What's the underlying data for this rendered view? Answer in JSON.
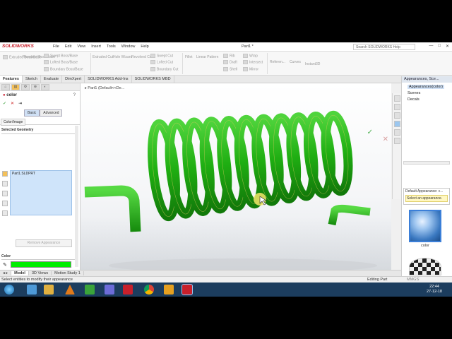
{
  "app": {
    "brand": "SOLIDWORKS",
    "menu": [
      "File",
      "Edit",
      "View",
      "Insert",
      "Tools",
      "Window",
      "Help"
    ],
    "document_title": "Part1 *",
    "search_placeholder": "Search SOLIDWORKS Help"
  },
  "commands": {
    "extruded_boss": "Extruded Boss/Base",
    "revolved_boss": "Revolved Boss/Base",
    "swept_boss": "Swept Boss/Base",
    "lofted_boss": "Lofted Boss/Base",
    "boundary_boss": "Boundary Boss/Base",
    "extruded_cut": "Extruded Cut",
    "hole_wizard": "Hole Wizard",
    "revolved_cut": "Revolved Cut",
    "swept_cut": "Swept Cut",
    "lofted_cut": "Lofted Cut",
    "boundary_cut": "Boundary Cut",
    "fillet": "Fillet",
    "linear_pattern": "Linear Pattern",
    "rib": "Rib",
    "draft": "Draft",
    "shell": "Shell",
    "wrap": "Wrap",
    "intersect": "Intersect",
    "mirror": "Mirror",
    "reference": "Referen...",
    "curves": "Curves",
    "instant3d": "Instant3D"
  },
  "tabs": [
    "Features",
    "Sketch",
    "Evaluate",
    "DimXpert",
    "SOLIDWORKS Add-Ins",
    "SOLIDWORKS MBD"
  ],
  "property_manager": {
    "title": "color",
    "help": "?",
    "ok": "✓",
    "cancel": "✕",
    "pin": "⇥",
    "basic": "Basic",
    "advanced": "Advanced",
    "subtab": "Color/Image",
    "selected_geometry_heading": "Selected Geometry",
    "selected_geometry_item": "Part1.SLDPRT",
    "remove_button": "Remove Appearance",
    "color_heading": "Color",
    "color_value": "#00ee00",
    "palette_select": "standard"
  },
  "viewport": {
    "tree_label": "Part1  (Default<<De...",
    "accent": "#1fae12"
  },
  "task_pane": {
    "title": "Appearances, Sce...",
    "tree": [
      "Appearances(color)",
      "Scenes",
      "Decals"
    ],
    "default_appearance": "Default Appearance: c...",
    "tip": "Select an appearance.",
    "thumbnails": [
      {
        "label": "color",
        "icon": "sphere-icon"
      },
      {
        "label": "texture",
        "icon": "checker-sphere-icon"
      }
    ]
  },
  "bottom_tabs": [
    "Model",
    "3D Views",
    "Motion Study 1"
  ],
  "status": {
    "message": "Select entities to modify their appearance",
    "mode": "Editing Part",
    "units": "MMGS"
  },
  "taskbar": {
    "time": "22:44",
    "date": "27-12-18"
  }
}
